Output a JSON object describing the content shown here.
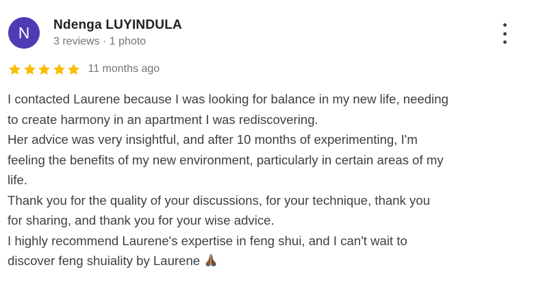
{
  "review": {
    "author": {
      "initial": "N",
      "name": "Ndenga LUYINDULA",
      "meta": "3 reviews · 1 photo"
    },
    "rating": 5,
    "rating_color": "#fbbc04",
    "avatar_color": "#4f3bb3",
    "time_ago": "11 months ago",
    "more_icon": "more-vert-icon",
    "text_lines": [
      "I contacted Laurene because I was looking for balance in my new life, needing",
      "to create harmony in an apartment I was rediscovering.",
      "Her advice was very insightful, and after 10 months of experimenting, I'm",
      "feeling the benefits of my new environment, particularly in certain areas of my",
      "life.",
      "Thank you for the quality of your discussions, for your technique, thank you",
      "for sharing, and thank you for your wise advice.",
      "I highly recommend Laurene's expertise in feng shui, and I can't wait to",
      "discover feng shuiality by Laurene"
    ],
    "trailing_emoji": "folded-hands-icon"
  }
}
